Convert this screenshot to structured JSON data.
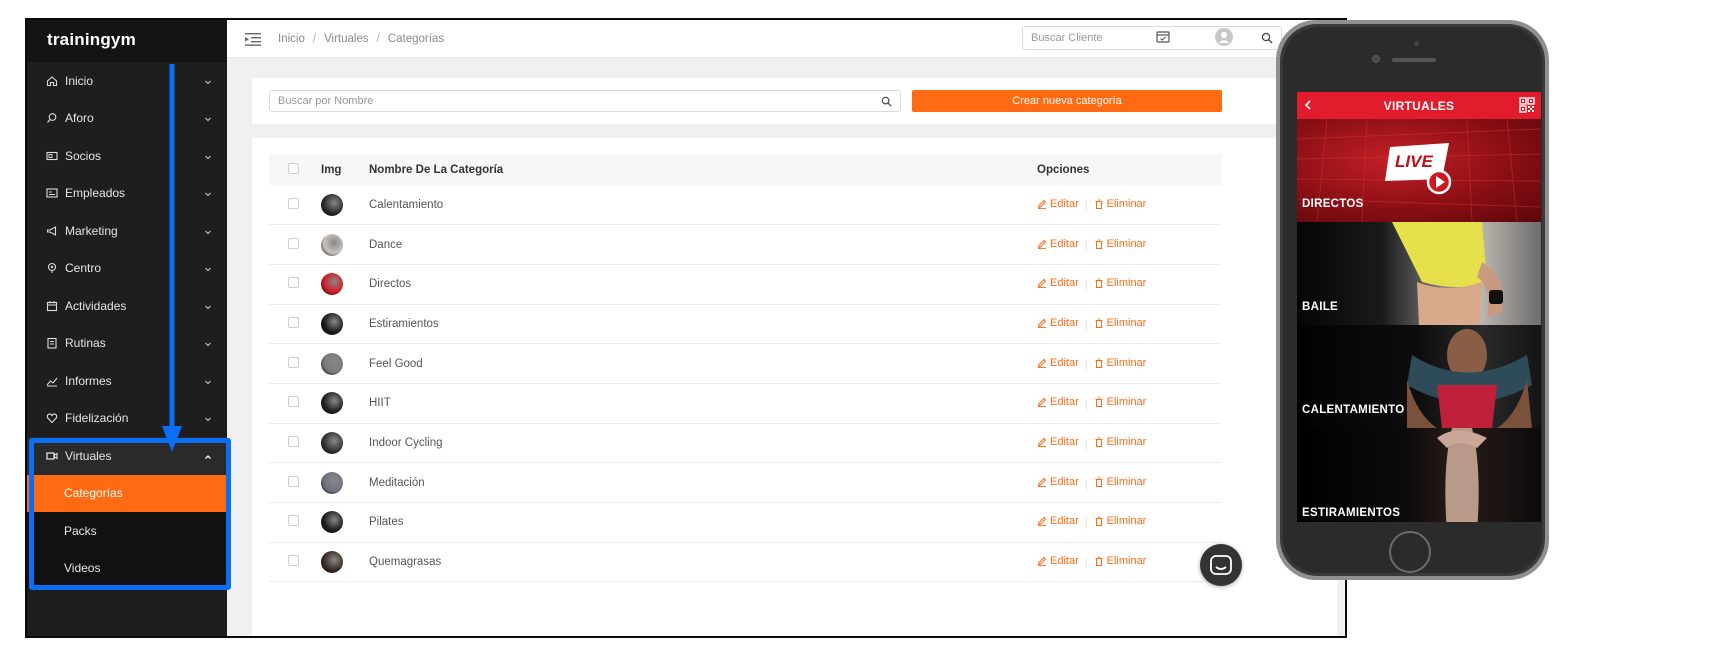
{
  "app": {
    "logo": "trainingym"
  },
  "sidebar": {
    "items": [
      {
        "label": "Inicio",
        "icon": "home-icon"
      },
      {
        "label": "Aforo",
        "icon": "search-icon"
      },
      {
        "label": "Socios",
        "icon": "id-card-icon"
      },
      {
        "label": "Empleados",
        "icon": "badge-icon"
      },
      {
        "label": "Marketing",
        "icon": "megaphone-icon"
      },
      {
        "label": "Centro",
        "icon": "location-icon"
      },
      {
        "label": "Actividades",
        "icon": "calendar-icon"
      },
      {
        "label": "Rutinas",
        "icon": "clipboard-icon"
      },
      {
        "label": "Informes",
        "icon": "chart-icon"
      },
      {
        "label": "Fidelización",
        "icon": "heart-icon"
      },
      {
        "label": "Virtuales",
        "icon": "video-icon"
      }
    ],
    "subitems": [
      {
        "label": "Categorías",
        "active": true
      },
      {
        "label": "Packs",
        "active": false
      },
      {
        "label": "Videos",
        "active": false
      }
    ]
  },
  "topbar": {
    "breadcrumb": [
      "Inicio",
      "Virtuales",
      "Categorías"
    ],
    "search_placeholder": "Buscar Cliente"
  },
  "filter": {
    "search_placeholder": "Buscar por Nombre",
    "create_button": "Crear nueva categoría"
  },
  "table": {
    "headers": {
      "img": "Img",
      "name": "Nombre De La Categoría",
      "options": "Opciones"
    },
    "edit_label": "Editar",
    "delete_label": "Eliminar",
    "rows": [
      {
        "name": "Calentamiento",
        "thumb": "#2a2a2a"
      },
      {
        "name": "Dance",
        "thumb": "#c9c2bc"
      },
      {
        "name": "Directos",
        "thumb": "#d21c26"
      },
      {
        "name": "Estiramientos",
        "thumb": "#1a1a1a"
      },
      {
        "name": "Feel Good",
        "thumb": "#7a7a7a"
      },
      {
        "name": "HIIT",
        "thumb": "#222222"
      },
      {
        "name": "Indoor Cycling",
        "thumb": "#333333"
      },
      {
        "name": "Meditación",
        "thumb": "#6d7480"
      },
      {
        "name": "Pilates",
        "thumb": "#1e1e1e"
      },
      {
        "name": "Quemagrasas",
        "thumb": "#3a2a24"
      }
    ]
  },
  "phone": {
    "app_title": "VIRTUALES",
    "cards": [
      {
        "label": "DIRECTOS",
        "badge": "LIVE"
      },
      {
        "label": "BAILE"
      },
      {
        "label": "CALENTAMIENTO"
      },
      {
        "label": "ESTIRAMIENTOS"
      }
    ]
  },
  "colors": {
    "accent": "#ff6a13",
    "highlight": "#0a6ff5",
    "app_red": "#e21c2c",
    "sidebar_bg": "#1e1e1e"
  }
}
